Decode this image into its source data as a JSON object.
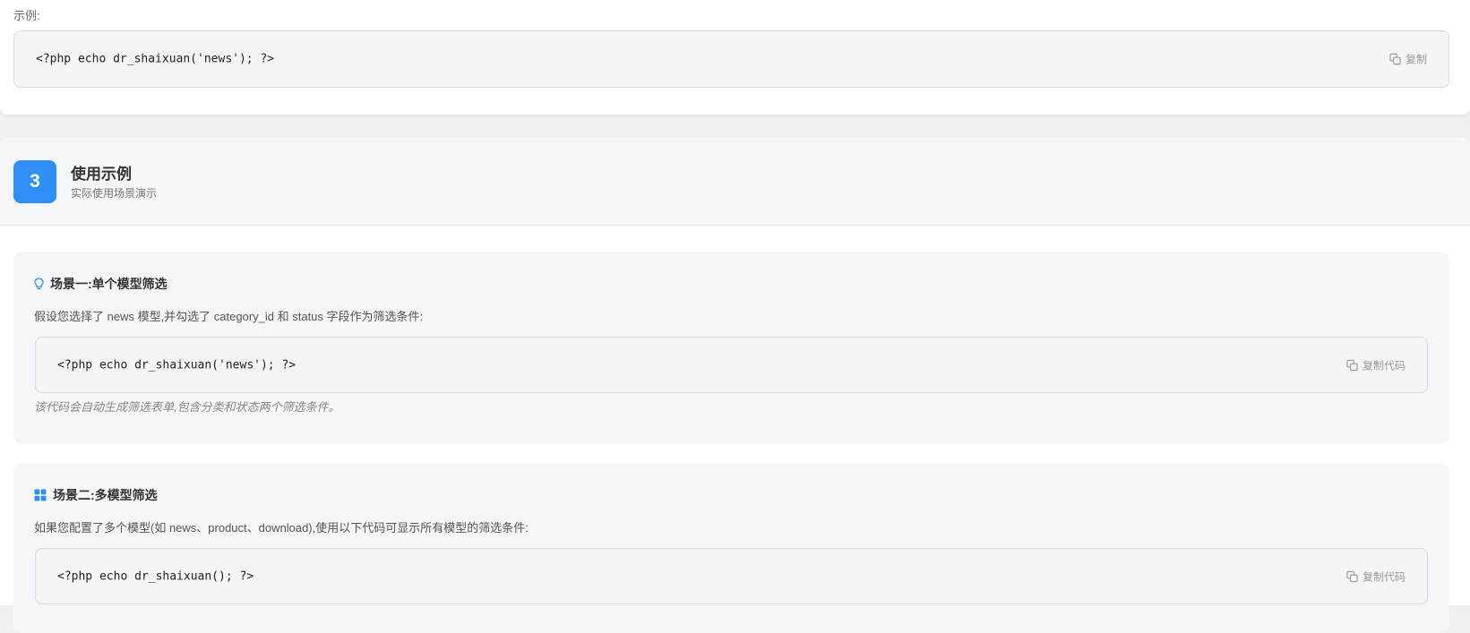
{
  "top": {
    "label": "示例:",
    "code": "<?php echo dr_shaixuan('news'); ?>",
    "copy_label": "复制"
  },
  "section3": {
    "number": "3",
    "title": "使用示例",
    "subtitle": "实际使用场景演示"
  },
  "scenario1": {
    "icon": "lightbulb-icon",
    "title": "场景一:单个模型筛选",
    "description": "假设您选择了 news 模型,并勾选了 category_id 和 status 字段作为筛选条件:",
    "code": "<?php echo dr_shaixuan('news'); ?>",
    "copy_label": "复制代码",
    "note": "该代码会自动生成筛选表单,包含分类和状态两个筛选条件。"
  },
  "scenario2": {
    "icon": "grid-icon",
    "title": "场景二:多模型筛选",
    "description": "如果您配置了多个模型(如 news、product、download),使用以下代码可显示所有模型的筛选条件:",
    "code": "<?php echo dr_shaixuan(); ?>",
    "copy_label": "复制代码"
  },
  "colors": {
    "accent": "#2f8ff8",
    "code_bg": "#f5f5f5",
    "card_bg": "#f4f6f9"
  }
}
